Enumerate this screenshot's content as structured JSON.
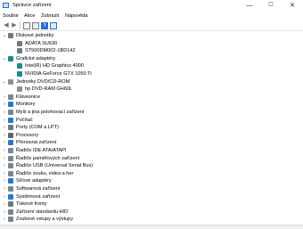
{
  "window": {
    "title": "Správce zařízení",
    "controls": {
      "minimize": "—",
      "maximize": "☐",
      "close": "✕"
    }
  },
  "menu": [
    "Soubor",
    "Akce",
    "Zobrazit",
    "Nápověda"
  ],
  "toolbar": {
    "buttons": [
      "back-icon",
      "forward-icon",
      "properties-icon",
      "device-list-icon",
      "help-icon",
      "monitor-icon"
    ],
    "help_glyph": "?"
  },
  "tree": {
    "expand_glyph": "›",
    "collapse_glyph": "⌄",
    "items": [
      {
        "label": "Diskové jednotky",
        "level": 0,
        "expanded": true,
        "icon": "disk-drive-icon",
        "color": "#6e7a86"
      },
      {
        "label": "ADATA SU630",
        "level": 1,
        "expanded": null,
        "icon": "disk-drive-icon",
        "color": "#6e7a86"
      },
      {
        "label": "ST500DM002-1BD142",
        "level": 1,
        "expanded": null,
        "icon": "disk-drive-icon",
        "color": "#6e7a86"
      },
      {
        "label": "Grafické adaptéry",
        "level": 0,
        "expanded": true,
        "icon": "display-adapter-icon",
        "color": "#1f8a8a"
      },
      {
        "label": "Intel(R) HD Graphics 4000",
        "level": 1,
        "expanded": null,
        "icon": "display-adapter-icon",
        "color": "#1f8a8a"
      },
      {
        "label": "NVIDIA GeForce GTX 1050 Ti",
        "level": 1,
        "expanded": null,
        "icon": "display-adapter-icon",
        "color": "#1f8a8a"
      },
      {
        "label": "Jednotky DVD/CD-ROM",
        "level": 0,
        "expanded": true,
        "icon": "dvd-drive-icon",
        "color": "#8a8f96"
      },
      {
        "label": "hp DVD-RAM GH60L",
        "level": 1,
        "expanded": null,
        "icon": "dvd-drive-icon",
        "color": "#8a8f96"
      },
      {
        "label": "Klávesnice",
        "level": 0,
        "expanded": false,
        "icon": "keyboard-icon",
        "color": "#7b8590"
      },
      {
        "label": "Monitory",
        "level": 0,
        "expanded": false,
        "icon": "monitor-icon",
        "color": "#2a78c6"
      },
      {
        "label": "Myši a jiná polohovací zařízení",
        "level": 0,
        "expanded": false,
        "icon": "mouse-icon",
        "color": "#7b8590"
      },
      {
        "label": "Počítač",
        "level": 0,
        "expanded": false,
        "icon": "computer-icon",
        "color": "#2a78c6"
      },
      {
        "label": "Porty (COM a LPT)",
        "level": 0,
        "expanded": false,
        "icon": "port-icon",
        "color": "#6f7780"
      },
      {
        "label": "Procesory",
        "level": 0,
        "expanded": false,
        "icon": "processor-icon",
        "color": "#5a6470"
      },
      {
        "label": "Přenosná zařízení",
        "level": 0,
        "expanded": false,
        "icon": "portable-device-icon",
        "color": "#2a78c6"
      },
      {
        "label": "Řadiče IDE ATA/ATAPI",
        "level": 0,
        "expanded": false,
        "icon": "ide-controller-icon",
        "color": "#7b8590"
      },
      {
        "label": "Řadiče paměťových zařízení",
        "level": 0,
        "expanded": false,
        "icon": "storage-controller-icon",
        "color": "#7b8590"
      },
      {
        "label": "Řadiče USB (Universal Serial Bus)",
        "level": 0,
        "expanded": false,
        "icon": "usb-controller-icon",
        "color": "#7b8590"
      },
      {
        "label": "Řadiče zvuku, videa a her",
        "level": 0,
        "expanded": false,
        "icon": "sound-controller-icon",
        "color": "#7b8590"
      },
      {
        "label": "Síťové adaptéry",
        "level": 0,
        "expanded": false,
        "icon": "network-adapter-icon",
        "color": "#2a78c6"
      },
      {
        "label": "Softwarová zařízení",
        "level": 0,
        "expanded": false,
        "icon": "software-device-icon",
        "color": "#7b8590"
      },
      {
        "label": "Systémová zařízení",
        "level": 0,
        "expanded": false,
        "icon": "system-device-icon",
        "color": "#2a78c6"
      },
      {
        "label": "Tiskové fronty",
        "level": 0,
        "expanded": false,
        "icon": "printer-icon",
        "color": "#6f7780"
      },
      {
        "label": "Zařízení standardu HID",
        "level": 0,
        "expanded": false,
        "icon": "hid-device-icon",
        "color": "#7b8590"
      },
      {
        "label": "Zvukové vstupy a výstupy",
        "level": 0,
        "expanded": false,
        "icon": "audio-io-icon",
        "color": "#7b8590"
      }
    ]
  }
}
